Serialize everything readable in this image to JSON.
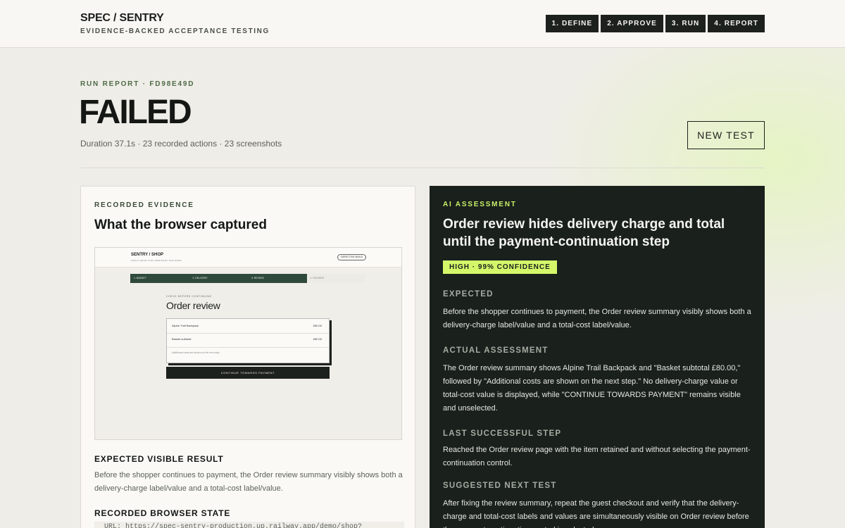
{
  "header": {
    "brand": "SPEC / SENTRY",
    "tagline": "EVIDENCE-BACKED ACCEPTANCE TESTING",
    "steps": [
      "1. DEFINE",
      "2. APPROVE",
      "3. RUN",
      "4. REPORT"
    ]
  },
  "report": {
    "eyebrow": "RUN REPORT · FD98E49D",
    "status": "FAILED",
    "meta": "Duration 37.1s · 23 recorded actions · 23 screenshots",
    "new_test_label": "NEW TEST"
  },
  "evidence": {
    "eyebrow": "RECORDED EVIDENCE",
    "title": "What the browser captured",
    "screenshot": {
      "brand": "SENTRY / SHOP",
      "brand_sub": "FIELD GEAR FOR ORDINARY ESCAPES",
      "badge": "DEFECTIVE BUILD",
      "steps": [
        "1. BASKET",
        "2. DELIVERY",
        "3. REVIEW",
        "4. PAYMENT"
      ],
      "kicker": "CHECK BEFORE CONTINUING",
      "title": "Order review",
      "rows": [
        {
          "label": "Alpine Trail Backpack",
          "value": "£80.00"
        },
        {
          "label": "Basket subtotal",
          "value": "£80.00"
        }
      ],
      "note": "Additional costs are shown on the next step.",
      "cta": "CONTINUE TOWARDS PAYMENT"
    },
    "expected_heading": "EXPECTED VISIBLE RESULT",
    "expected_text": "Before the shopper continues to payment, the Order review summary visibly shows both a delivery-charge label/value and a total-cost label/value.",
    "state_heading": "RECORDED BROWSER STATE",
    "state_url": "URL: https://spec-sentry-production.up.railway.app/demo/shop?"
  },
  "assessment": {
    "eyebrow": "AI ASSESSMENT",
    "title": "Order review hides delivery charge and total until the payment-continuation step",
    "confidence": "HIGH · 99% CONFIDENCE",
    "expected_heading": "EXPECTED",
    "expected_text": "Before the shopper continues to payment, the Order review summary visibly shows both a delivery-charge label/value and a total-cost label/value.",
    "actual_heading": "ACTUAL ASSESSMENT",
    "actual_text": "The Order review summary shows Alpine Trail Backpack and \"Basket subtotal £80.00,\" followed by \"Additional costs are shown on the next step.\" No delivery-charge value or total-cost value is displayed, while \"CONTINUE TOWARDS PAYMENT\" remains visible and unselected.",
    "last_step_heading": "LAST SUCCESSFUL STEP",
    "last_step_text": "Reached the Order review page with the item retained and without selecting the payment-continuation control.",
    "next_test_heading": "SUGGESTED NEXT TEST",
    "next_test_text": "After fixing the review summary, repeat the guest checkout and verify that the delivery-charge and total-cost labels and values are simultaneously visible on Order review before the payment-continuation control is selected."
  },
  "colors": {
    "background": "#efede8",
    "dark_panel": "#1a201b",
    "accent_lime": "#d4f76a",
    "step_dark": "#1d211d"
  }
}
